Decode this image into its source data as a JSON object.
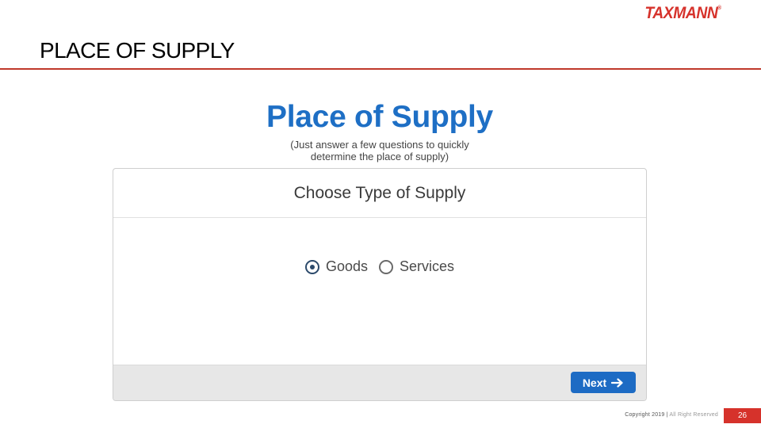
{
  "header": {
    "logo_text": "TAXMANN",
    "logo_mark": "®",
    "slide_title": "PLACE OF SUPPLY",
    "brand_color": "#d6322b"
  },
  "app": {
    "heading": "Place of Supply",
    "subtitle_line1": "(Just answer a few questions to quickly",
    "subtitle_line2": "determine the place of supply)",
    "accent_color": "#1e6fc5"
  },
  "card": {
    "title": "Choose Type of Supply",
    "options": [
      {
        "label": "Goods",
        "selected": true
      },
      {
        "label": "Services",
        "selected": false
      }
    ],
    "next_label": "Next",
    "next_icon": "arrow-right-icon"
  },
  "footer": {
    "copyright": "Copyright 2019 |",
    "rights": "All Right Reserved",
    "page_number": "26"
  }
}
